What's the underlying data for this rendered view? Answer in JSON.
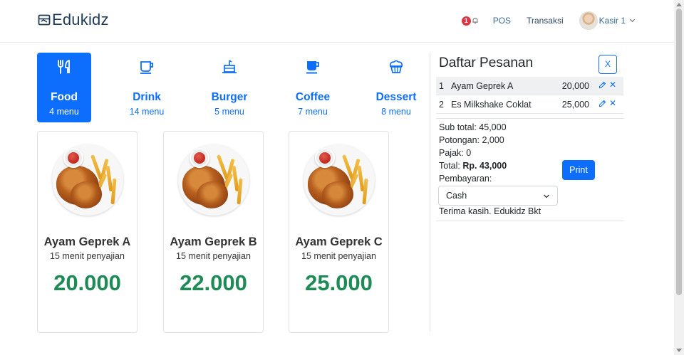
{
  "brand": {
    "name": "Edukidz"
  },
  "navbar": {
    "notification_count": "1",
    "links": [
      "POS",
      "Transaksi"
    ],
    "user_name": "Kasir 1"
  },
  "categories": [
    {
      "name": "Food",
      "count": "4 menu",
      "icon": "fork-knife-icon",
      "active": true
    },
    {
      "name": "Drink",
      "count": "14 menu",
      "icon": "mug-icon",
      "active": false
    },
    {
      "name": "Burger",
      "count": "5 menu",
      "icon": "cake-icon",
      "active": false
    },
    {
      "name": "Coffee",
      "count": "7 menu",
      "icon": "cup-icon",
      "active": false
    },
    {
      "name": "Dessert",
      "count": "8 menu",
      "icon": "muffin-icon",
      "active": false
    }
  ],
  "products": [
    {
      "name": "Ayam Geprek A",
      "time": "15 menit penyajian",
      "price": "20.000"
    },
    {
      "name": "Ayam Geprek B",
      "time": "15 menit penyajian",
      "price": "22.000"
    },
    {
      "name": "Ayam Geprek C",
      "time": "15 menit penyajian",
      "price": "25.000"
    }
  ],
  "order": {
    "title": "Daftar Pesanan",
    "close_label": "X",
    "items": [
      {
        "no": "1",
        "name": "Ayam Geprek A",
        "price": "20,000"
      },
      {
        "no": "2",
        "name": "Es Milkshake Coklat",
        "price": "25,000"
      }
    ],
    "subtotal": "Sub total: 45,000",
    "discount": "Potongan: 2,000",
    "tax": "Pajak: 0",
    "total_label": "Total:",
    "total_value": "Rp. 43,000",
    "payment_label": "Pembayaran:",
    "payment_value": "Cash",
    "print_label": "Print",
    "thanks": "Terima kasih. Edukidz Bkt"
  },
  "colors": {
    "primary": "#0d6efd",
    "price": "#1e8a55",
    "danger": "#dc3545"
  }
}
